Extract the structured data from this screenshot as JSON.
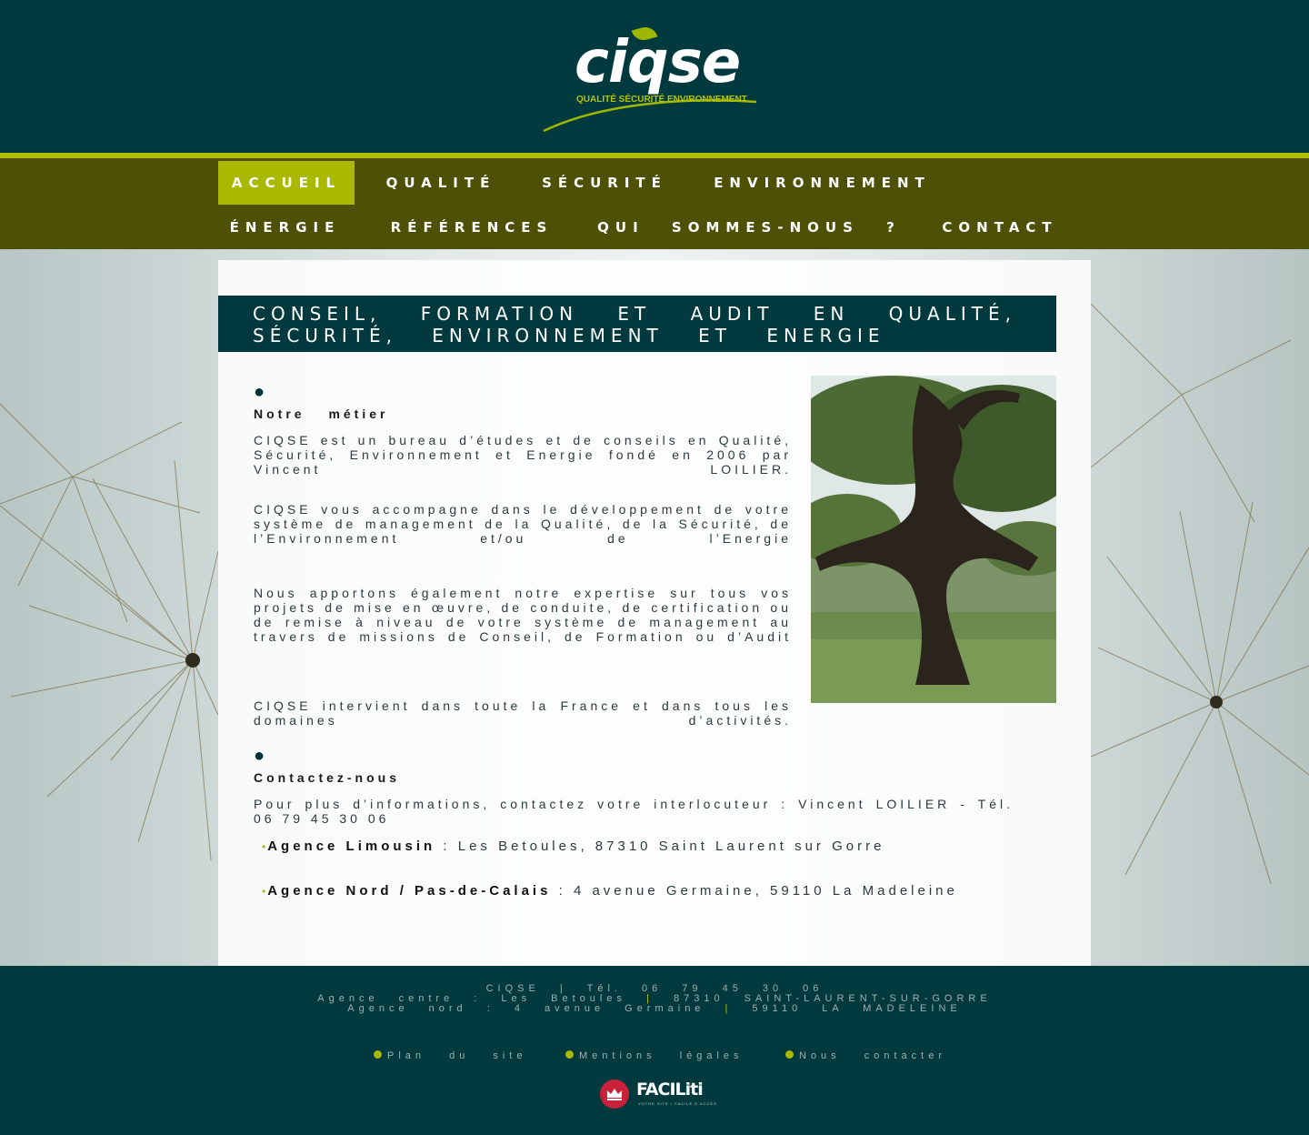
{
  "header": {
    "logo_text": "ciqse",
    "logo_subtitle": "QUALITÉ SÉCURITÉ ENVIRONNEMENT"
  },
  "nav": {
    "items": [
      {
        "label": "ACCUEIL",
        "active": true
      },
      {
        "label": "QUALITÉ",
        "active": false
      },
      {
        "label": "SÉCURITÉ",
        "active": false
      },
      {
        "label": "ENVIRONNEMENT",
        "active": false
      },
      {
        "label": "ÉNERGIE",
        "active": false
      },
      {
        "label": "RÉFÉRENCES",
        "active": false
      },
      {
        "label": "QUI SOMMES-NOUS ?",
        "active": false
      },
      {
        "label": "CONTACT",
        "active": false
      }
    ]
  },
  "main": {
    "title": "Conseil, formation et audit en Qualité, Sécurité, Environnement et Energie",
    "section1": {
      "heading": "Notre métier",
      "paragraphs": [
        "CIQSE est un bureau d’études et de conseils en Qualité, Sécurité, Environnement et Energie fondé en 2006 par Vincent LOILIER.",
        "CIQSE vous accompagne dans le développement de votre système de management de la Qualité, de la Sécurité, de l’Environnement et/ou de l’Energie",
        "Nous apportons également notre expertise sur tous vos projets de mise en œuvre, de conduite, de certification ou de remise à niveau de votre système de management au travers de missions de Conseil, de Formation ou d’Audit",
        "CIQSE intervient dans toute la France et dans tous les domaines d’activités."
      ]
    },
    "section2": {
      "heading": "Contactez-nous",
      "intro": "Pour plus d’informations, contactez votre interlocuteur : Vincent LOILIER - Tél. 06 79 45 30 06",
      "agencies": [
        {
          "name": "Agence Limousin",
          "address": " : Les Betoules, 87310 Saint Laurent sur Gorre"
        },
        {
          "name": "Agence Nord / Pas-de-Calais",
          "address": " : 4 avenue Germaine, 59110 La Madeleine"
        }
      ]
    }
  },
  "footer": {
    "line1_a": "CIQSE",
    "line1_sep": "|",
    "line1_b": "Tél. 06 79 45 30 06",
    "line2_a": "Agence centre : Les Betoules",
    "line2_sep1": "|",
    "line2_b": "87310 SAINT-LAURENT-SUR-GORRE",
    "line3_a": "Agence nord : 4 avenue Germaine",
    "line3_sep1": "|",
    "line3_b": "59110 LA MADELEINE",
    "links": [
      "Plan du site",
      "Mentions légales",
      "Nous contacter"
    ],
    "faciliti_name": "FACILiti",
    "faciliti_tagline": "VOTRE SITE • FACILE D'ACCÈS"
  },
  "colors": {
    "dark_teal": "#003a3e",
    "olive_nav": "#4e5005",
    "accent_green": "#a9b800"
  }
}
